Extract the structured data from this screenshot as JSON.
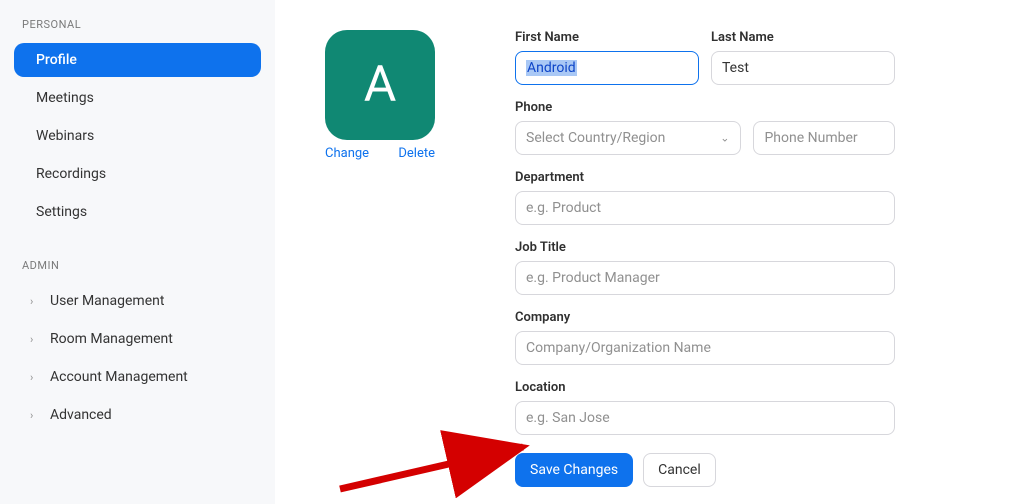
{
  "colors": {
    "primary": "#0e72ed",
    "avatarBg": "#108873"
  },
  "sidebar": {
    "personal": {
      "header": "PERSONAL",
      "items": [
        {
          "label": "Profile",
          "active": true
        },
        {
          "label": "Meetings"
        },
        {
          "label": "Webinars"
        },
        {
          "label": "Recordings"
        },
        {
          "label": "Settings"
        }
      ]
    },
    "admin": {
      "header": "ADMIN",
      "items": [
        {
          "label": "User Management"
        },
        {
          "label": "Room Management"
        },
        {
          "label": "Account Management"
        },
        {
          "label": "Advanced"
        }
      ]
    }
  },
  "avatar": {
    "initial": "A",
    "change": "Change",
    "delete": "Delete"
  },
  "form": {
    "firstName": {
      "label": "First Name",
      "value": "Android"
    },
    "lastName": {
      "label": "Last Name",
      "value": "Test"
    },
    "phone": {
      "label": "Phone",
      "countryPlaceholder": "Select Country/Region",
      "numberPlaceholder": "Phone Number"
    },
    "department": {
      "label": "Department",
      "placeholder": "e.g. Product"
    },
    "jobTitle": {
      "label": "Job Title",
      "placeholder": "e.g. Product Manager"
    },
    "company": {
      "label": "Company",
      "placeholder": "Company/Organization Name"
    },
    "location": {
      "label": "Location",
      "placeholder": "e.g. San Jose"
    },
    "save": "Save Changes",
    "cancel": "Cancel"
  }
}
